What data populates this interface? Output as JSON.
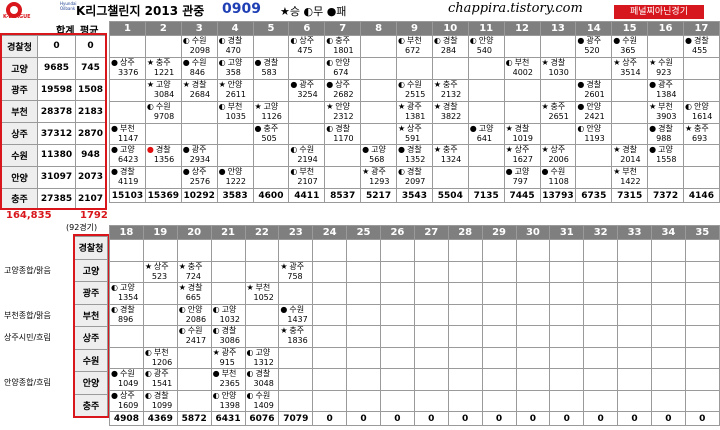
{
  "header": {
    "logo_text": "K-LEAGUE",
    "sponsor_text": "Hyundai Oilbank",
    "title": "K리그챌린지 2013 관중",
    "title_num": "0909",
    "legend": "★승 ◐무 ●패",
    "site": "chappira.tistory.com",
    "badge": "페널찌아닌경기"
  },
  "summary": {
    "col_total": "합계",
    "col_avg": "평균",
    "teams": [
      {
        "name": "경찰청",
        "total": "0",
        "avg": "0"
      },
      {
        "name": "고양",
        "total": "9685",
        "avg": "745"
      },
      {
        "name": "광주",
        "total": "19598",
        "avg": "1508"
      },
      {
        "name": "부천",
        "total": "28378",
        "avg": "2183"
      },
      {
        "name": "상주",
        "total": "37312",
        "avg": "2870"
      },
      {
        "name": "수원",
        "total": "11380",
        "avg": "948"
      },
      {
        "name": "안양",
        "total": "31097",
        "avg": "2073"
      },
      {
        "name": "충주",
        "total": "27385",
        "avg": "2107"
      }
    ],
    "grand_total": "164,835",
    "grand_avg": "1792",
    "games_note": "(92경기)"
  },
  "top": {
    "rounds": [
      "1",
      "2",
      "3",
      "4",
      "5",
      "6",
      "7",
      "8",
      "9",
      "10",
      "11",
      "12",
      "13",
      "14",
      "15",
      "16",
      "17"
    ],
    "rows": [
      [
        "",
        "",
        "◐|수원|2098",
        "◐|경찰|470",
        "",
        "◐|상주|475",
        "◐|충주|1801",
        "",
        "◐|부천|672",
        "◐|경찰|284",
        "◐|안양|540",
        "",
        "",
        "●|광주|520",
        "●|수원|365",
        "",
        "●|경찰|455"
      ],
      [
        "●|상주|3376",
        "★|충주|1221",
        "●|수원|846",
        "◐|고양|358",
        "●|경찰|583",
        "",
        "◐|안양|674",
        "",
        "",
        "",
        "",
        "◐|부천|4002",
        "★|경찰|1030",
        "",
        "★|상주|3514",
        "★|수원|923",
        ""
      ],
      [
        "",
        "★|고양|3084",
        "★|경찰|2684",
        "★|안양|2611",
        "",
        "●|광주|3254",
        "●|상주|2682",
        "",
        "◐|수원|2515",
        "★|충주|2132",
        "",
        "",
        "",
        "●|경찰|2601",
        "",
        "●|광주|1384",
        ""
      ],
      [
        "",
        "◐|수원|9708",
        "",
        "◐|부천|1035",
        "★|고양|1126",
        "",
        "★|안양|2312",
        "",
        "★|광주|1381",
        "★|경찰|3822",
        "",
        "",
        "★|충주|2651",
        "●|안양|2421",
        "",
        "★|부천|3903",
        "◐|안양|1614"
      ],
      [
        "●|부천|1147",
        "",
        "",
        "",
        "●|충주|505",
        "",
        "◐|경찰|1170",
        "",
        "★|상주|591",
        "",
        "●|고양|641",
        "★|경찰|1019",
        "",
        "◐|안양|1193",
        "",
        "●|경찰|988",
        "★|충주|693"
      ],
      [
        "●|고양|6423",
        "●|경찰|1356",
        "●|광주|2934",
        "",
        "",
        "◐|수원|2194",
        "",
        "●|고양|568",
        "●|경찰|1352",
        "★|충주|1324",
        "",
        "★|상주|1627",
        "★|상주|2006",
        "",
        "★|경찰|2014",
        "●|고양|1558",
        ""
      ],
      [
        "●|경찰|4119",
        "",
        "●|상주|2576",
        "●|안양|1222",
        "",
        "◐|부천|2107",
        "",
        "★|광주|1293",
        "◐|경찰|2097",
        "",
        "",
        "●|고양|797",
        "●|수원|1108",
        "",
        "★|부천|1422",
        "",
        ""
      ]
    ],
    "totals": [
      "15103",
      "15369",
      "10292",
      "3583",
      "4600",
      "4411",
      "8537",
      "5217",
      "3543",
      "5504",
      "7135",
      "7445",
      "13793",
      "6735",
      "7315",
      "7372",
      "4146"
    ]
  },
  "bottom": {
    "rounds": [
      "18",
      "19",
      "20",
      "21",
      "22",
      "23",
      "24",
      "25",
      "26",
      "27",
      "28",
      "29",
      "30",
      "31",
      "32",
      "33",
      "34",
      "35"
    ],
    "row_labels": [
      "경찰청",
      "고양",
      "광주",
      "부천",
      "상주",
      "수원",
      "안양",
      "충주"
    ],
    "side_notes": [
      "",
      "고양종합/맑음",
      "",
      "부천종합/맑음",
      "상주시민/흐림",
      "",
      "안양종합/흐림",
      ""
    ],
    "rows": [
      [
        "",
        "",
        "",
        "",
        "",
        "",
        "",
        "",
        "",
        "",
        "",
        "",
        "",
        "",
        "",
        "",
        "",
        ""
      ],
      [
        "",
        "★|상주|523",
        "★|충주|724",
        "",
        "",
        "★|광주|758",
        "",
        "",
        "",
        "",
        "",
        "",
        "",
        "",
        "",
        "",
        "",
        ""
      ],
      [
        "◐|고양|1354",
        "",
        "★|경찰|665",
        "",
        "★|부천|1052",
        "",
        "",
        "",
        "",
        "",
        "",
        "",
        "",
        "",
        "",
        "",
        "",
        ""
      ],
      [
        "◐|경찰|896",
        "",
        "◐|안양|2086",
        "◐|고양|1032",
        "",
        "●|수원|1437",
        "",
        "",
        "",
        "",
        "",
        "",
        "",
        "",
        "",
        "",
        "",
        ""
      ],
      [
        "",
        "",
        "◐|수원|2417",
        "◐|경찰|3086",
        "",
        "★|충주|1836",
        "",
        "",
        "",
        "",
        "",
        "",
        "",
        "",
        "",
        "",
        "",
        ""
      ],
      [
        "",
        "◐|부천|1206",
        "",
        "★|광주|915",
        "◐|고양|1312",
        "",
        "",
        "",
        "",
        "",
        "",
        "",
        "",
        "",
        "",
        "",
        "",
        ""
      ],
      [
        "●|수원|1049",
        "◐|광주|1541",
        "",
        "●|부천|2365",
        "◐|경찰|3048",
        "",
        "",
        "",
        "",
        "",
        "",
        "",
        "",
        "",
        "",
        "",
        "",
        ""
      ],
      [
        "●|상주|1609",
        "◐|경찰|1099",
        "",
        "◐|안양|1398",
        "◐|수원|1409",
        "",
        "",
        "",
        "",
        "",
        "",
        "",
        "",
        "",
        "",
        "",
        "",
        ""
      ]
    ],
    "totals": [
      "4908",
      "4369",
      "5872",
      "6431",
      "6076",
      "7079",
      "0",
      "0",
      "0",
      "0",
      "0",
      "0",
      "0",
      "0",
      "0",
      "0",
      "0",
      "0"
    ]
  }
}
